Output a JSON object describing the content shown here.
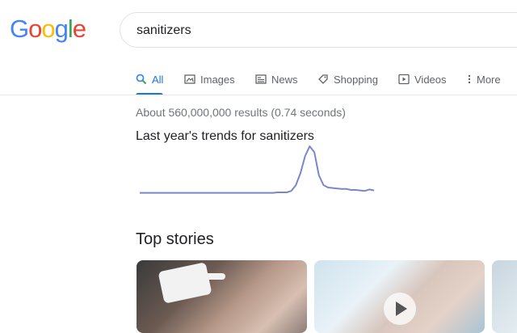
{
  "logo": {
    "letters": [
      "G",
      "o",
      "o",
      "g",
      "l",
      "e"
    ],
    "colors": [
      "#4285F4",
      "#EA4335",
      "#FBBC05",
      "#4285F4",
      "#34A853",
      "#EA4335"
    ]
  },
  "search": {
    "query": "sanitizers"
  },
  "tabs": [
    {
      "label": "All",
      "icon": "search-icon",
      "active": true
    },
    {
      "label": "Images",
      "icon": "image-icon",
      "active": false
    },
    {
      "label": "News",
      "icon": "news-icon",
      "active": false
    },
    {
      "label": "Shopping",
      "icon": "tag-icon",
      "active": false
    },
    {
      "label": "Videos",
      "icon": "play-box-icon",
      "active": false
    },
    {
      "label": "More",
      "icon": "more-vert-icon",
      "active": false
    }
  ],
  "result_stats": "About 560,000,000 results (0.74 seconds)",
  "trends": {
    "title": "Last year's trends for sanitizers",
    "line_color": "#7986cb"
  },
  "chart_data": {
    "type": "line",
    "title": "",
    "xlabel": "",
    "ylabel": "",
    "x": [
      0,
      1,
      2,
      3,
      4,
      5,
      6,
      7,
      8,
      9,
      10,
      11,
      12,
      13,
      14,
      15,
      16,
      17,
      18,
      19,
      20,
      21,
      22,
      23,
      24,
      25,
      26,
      27,
      28,
      29,
      30,
      31,
      32,
      33,
      34,
      35,
      36,
      37,
      38,
      39,
      40,
      41,
      42,
      43,
      44,
      45,
      46,
      47,
      48,
      49,
      50,
      51
    ],
    "series": [
      {
        "values": [
          4,
          4,
          4,
          4,
          4,
          4,
          4,
          4,
          4,
          4,
          4,
          4,
          4,
          4,
          4,
          4,
          4,
          4,
          4,
          4,
          4,
          4,
          4,
          4,
          4,
          4,
          4,
          4,
          4,
          4,
          5,
          5,
          5,
          8,
          20,
          45,
          80,
          100,
          88,
          40,
          20,
          15,
          14,
          13,
          12,
          12,
          10,
          10,
          9,
          8,
          11,
          9
        ]
      }
    ],
    "ylim": [
      0,
      100
    ]
  },
  "top_stories": {
    "title": "Top stories",
    "cards": [
      {
        "has_video": false
      },
      {
        "has_video": true
      },
      {
        "has_video": false
      }
    ]
  }
}
